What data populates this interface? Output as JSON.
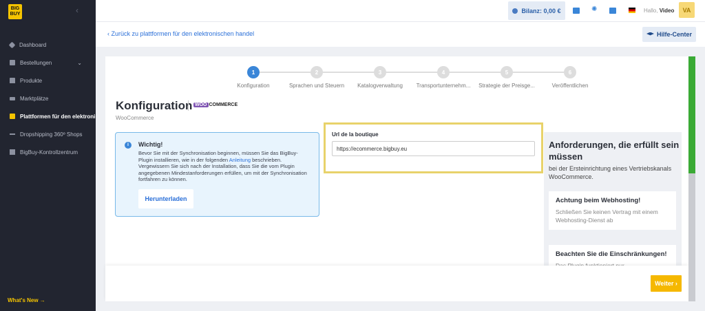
{
  "sidebar": {
    "logo": "BIG BUY",
    "items": [
      {
        "label": "Dashboard",
        "icon": "dashboard-icon"
      },
      {
        "label": "Bestellungen",
        "icon": "orders-icon",
        "has_submenu": true
      },
      {
        "label": "Produkte",
        "icon": "products-icon"
      },
      {
        "label": "Marktplätze",
        "icon": "marketplace-icon"
      },
      {
        "label": "Plattformen für den elektronischen handel",
        "icon": "platform-icon",
        "active": true
      },
      {
        "label": "Dropshipping 360º Shops",
        "icon": "shops-icon"
      },
      {
        "label": "BigBuy-Kontrollzentrum",
        "icon": "control-center-icon"
      }
    ],
    "whats_new": "What's New →"
  },
  "topbar": {
    "balance": "Bilanz: 0,00 €",
    "hello": "Hallo,",
    "user": "Video",
    "avatar": "VA"
  },
  "subheader": {
    "back_link": "Zurück zu plattformen für den elektronischen handel",
    "help": "Hilfe-Center"
  },
  "steps": [
    {
      "num": "1",
      "label": "Konfiguration",
      "active": true
    },
    {
      "num": "2",
      "label": "Sprachen und Steuern"
    },
    {
      "num": "3",
      "label": "Katalogverwaltung"
    },
    {
      "num": "4",
      "label": "Transportunternehm..."
    },
    {
      "num": "5",
      "label": "Strategie der Preisge..."
    },
    {
      "num": "6",
      "label": "Veröffentlichen"
    }
  ],
  "page": {
    "title": "Konfiguration",
    "woo_logo_a": "WOO",
    "woo_logo_b": "COMMERCE",
    "subtitle": "WooCommerce"
  },
  "info": {
    "title": "Wichtig!",
    "text_before_link": "Bevor Sie mit der Synchronisation beginnen, müssen Sie das BigBuy-Plugin installieren, wie in der folgenden ",
    "link": "Anleitung",
    "text_after_link": " beschrieben. Vergewissern Sie sich nach der Installation, dass Sie die vom Plugin angegebenen Mindestanforderungen erfüllen, um mit der Synchronisation fortfahren zu können.",
    "download": "Herunterladen"
  },
  "url_field": {
    "label": "Url de la boutique",
    "value": "https://ecommerce.bigbuy.eu"
  },
  "requirements": {
    "title": "Anforderungen, die erfüllt sein müssen",
    "subtitle": "bei der Ersteinrichtung eines Vertriebskanals WooCommerce.",
    "cards": [
      {
        "title": "Achtung beim Webhosting!",
        "text": "Schließen Sie keinen Vertrag mit einem Webhosting-Dienst ab"
      },
      {
        "title": "Beachten Sie die Einschränkungen!",
        "text": "Das Plugin funktioniert nur"
      }
    ]
  },
  "footer": {
    "next": "Weiter ›"
  }
}
